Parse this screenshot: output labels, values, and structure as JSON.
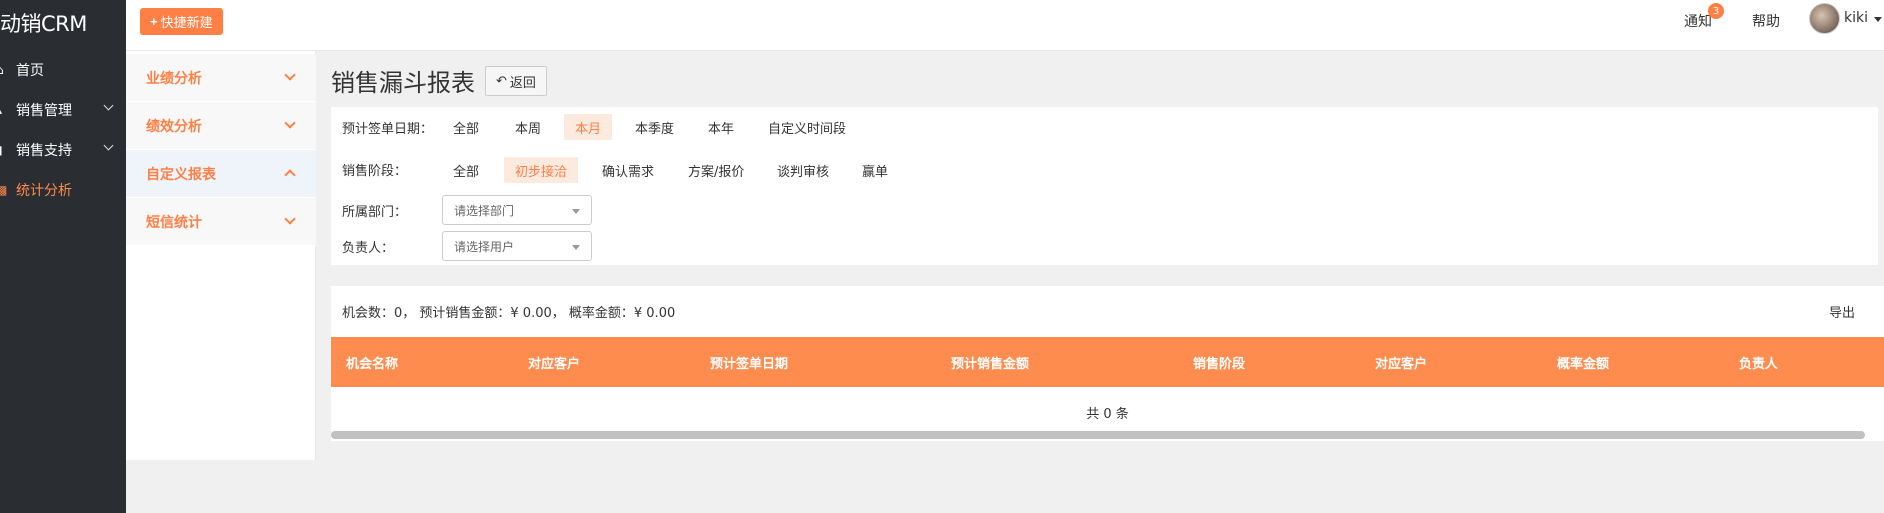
{
  "sidebar": {
    "brand": "动销CRM",
    "items": [
      {
        "label": "首页",
        "icon": "home-icon"
      },
      {
        "label": "销售管理",
        "icon": "chart-icon",
        "expandable": true
      },
      {
        "label": "销售支持",
        "icon": "support-icon",
        "expandable": true
      },
      {
        "label": "统计分析",
        "icon": "stats-icon",
        "active": true
      }
    ]
  },
  "header": {
    "quick_new": "快捷新建",
    "notify": "通知",
    "notify_count": "3",
    "help": "帮助",
    "username": "kiki"
  },
  "submenu": {
    "items": [
      {
        "label": "业绩分析"
      },
      {
        "label": "绩效分析"
      },
      {
        "label": "自定义报表",
        "open": true
      },
      {
        "label": "短信统计"
      }
    ]
  },
  "main": {
    "title": "销售漏斗报表",
    "back": "返回"
  },
  "filters": {
    "date_label": "预计签单日期：",
    "date_options": [
      "全部",
      "本周",
      "本月",
      "本季度",
      "本年",
      "自定义时间段"
    ],
    "date_selected": "本月",
    "stage_label": "销售阶段：",
    "stage_options": [
      "全部",
      "初步接洽",
      "确认需求",
      "方案/报价",
      "谈判审核",
      "赢单"
    ],
    "stage_selected": "初步接洽",
    "dept_label": "所属部门：",
    "dept_placeholder": "请选择部门",
    "owner_label": "负责人：",
    "owner_placeholder": "请选择用户"
  },
  "table": {
    "summary": "机会数：0， 预计销售金额：¥ 0.00， 概率金额：¥ 0.00",
    "export": "导出",
    "columns": [
      "机会名称",
      "对应客户",
      "预计签单日期",
      "预计销售金额",
      "销售阶段",
      "对应客户",
      "概率金额",
      "负责人"
    ],
    "total": "共 0 条"
  },
  "colors": {
    "accent": "#ff7f45",
    "table_header": "#ff8c4f",
    "sidebar_bg": "#2a2e33"
  }
}
